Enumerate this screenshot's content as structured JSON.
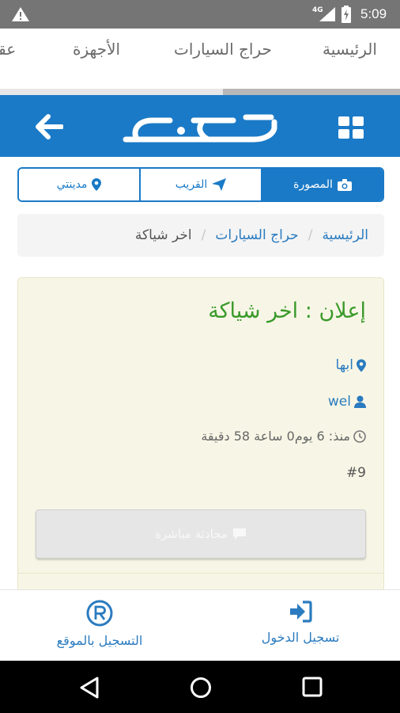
{
  "status_bar": {
    "network": "4G",
    "time": "5:09"
  },
  "tabs": [
    {
      "label": "الرئيسية"
    },
    {
      "label": "حراج السيارات"
    },
    {
      "label": "الأجهزة"
    },
    {
      "label": "عقا"
    }
  ],
  "header": {
    "logo_text": "حراج"
  },
  "filters": [
    {
      "label": "المصورة",
      "icon": "camera-icon",
      "active": true
    },
    {
      "label": "القريب",
      "icon": "paper-plane-icon",
      "active": false
    },
    {
      "label": "مدينتي",
      "icon": "map-marker-icon",
      "active": false
    }
  ],
  "breadcrumb": {
    "home": "الرئيسية",
    "category": "حراج السيارات",
    "current": "اخر شياكة",
    "separator": "/"
  },
  "ad": {
    "title": "إعلان : اخر شياكة",
    "city": "ابها",
    "user": "wel",
    "time": "منذ: 6 يوم0 ساعة 58 دقيقة",
    "number": "#9",
    "chat_button": "محادثة مباشرة"
  },
  "bottom_bar": {
    "login_label": "تسجيل الدخول",
    "register_label": "التسجيل بالموقع"
  },
  "colors": {
    "brand_blue": "#1a7ac7",
    "title_green": "#3a9a2a",
    "link_blue": "#2a7bbf"
  }
}
